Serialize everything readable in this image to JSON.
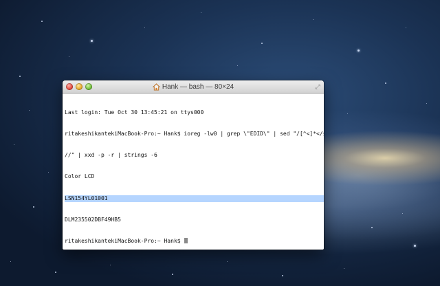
{
  "window": {
    "title": "Hank — bash — 80×24",
    "icon": "home-folder-icon",
    "resize_icon": "⤢"
  },
  "terminal": {
    "lines": [
      "Last login: Tue Oct 30 13:45:21 on ttys000",
      "ritakeshikantekiMacBook-Pro:~ Hank$ ioreg -lw0 | grep \\\"EDID\\\" | sed \"/[^<]*</s/",
      "//\" | xxd -p -r | strings -6",
      "Color LCD",
      "LSN154YL01001",
      "DLM235502DBF49HB5",
      "ritakeshikantekiMacBook-Pro:~ Hank$ "
    ],
    "selected_line_index": 4
  },
  "colors": {
    "selection": "#b5d5ff",
    "text": "#111111"
  }
}
